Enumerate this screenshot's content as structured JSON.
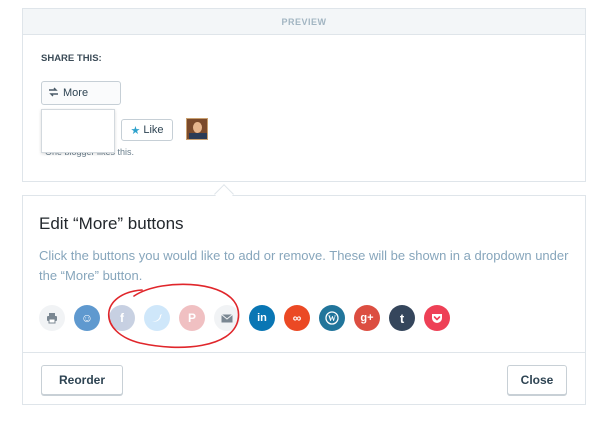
{
  "preview": {
    "header": "PREVIEW",
    "share_label": "SHARE THIS:",
    "more_label": "More",
    "like_label": "Like",
    "likes_text": "One blogger likes this."
  },
  "editor": {
    "title": "Edit “More” buttons",
    "description": "Click the buttons you would like to add or remove. These will be shown in a dropdown under the “More” button.",
    "services": [
      {
        "name": "print",
        "icon": "printer-icon",
        "color": "#f1f3f5",
        "enabled": true
      },
      {
        "name": "reddit",
        "icon": "reddit-icon",
        "color": "#5f99cf",
        "enabled": true
      },
      {
        "name": "facebook",
        "icon": "facebook-icon",
        "color": "#3b5998",
        "enabled": false
      },
      {
        "name": "twitter",
        "icon": "twitter-icon",
        "color": "#55acee",
        "enabled": false
      },
      {
        "name": "pinterest",
        "icon": "pinterest-icon",
        "color": "#cb2027",
        "enabled": false
      },
      {
        "name": "email",
        "icon": "email-icon",
        "color": "#f1f3f5",
        "enabled": true
      },
      {
        "name": "linkedin",
        "icon": "linkedin-icon",
        "color": "#0976b4",
        "enabled": true
      },
      {
        "name": "stumbleupon",
        "icon": "stumbleupon-icon",
        "color": "#eb4924",
        "enabled": true
      },
      {
        "name": "wordpress",
        "icon": "wordpress-icon",
        "color": "#21759b",
        "enabled": true
      },
      {
        "name": "google-plus",
        "icon": "google-plus-icon",
        "color": "#dc4e41",
        "enabled": true
      },
      {
        "name": "tumblr",
        "icon": "tumblr-icon",
        "color": "#35465c",
        "enabled": true
      },
      {
        "name": "pocket",
        "icon": "pocket-icon",
        "color": "#ee4056",
        "enabled": true
      }
    ],
    "reorder_label": "Reorder",
    "close_label": "Close"
  },
  "glyphs": {
    "reddit": "☺",
    "facebook": "f",
    "twitter": "✉",
    "pinterest": "P",
    "linkedin": "in",
    "stumbleupon": "∞",
    "wordpress": "W",
    "google_plus": "g+",
    "tumblr": "t"
  },
  "annotation": {
    "color": "#e0262b",
    "shape": "hand-drawn-circle"
  }
}
